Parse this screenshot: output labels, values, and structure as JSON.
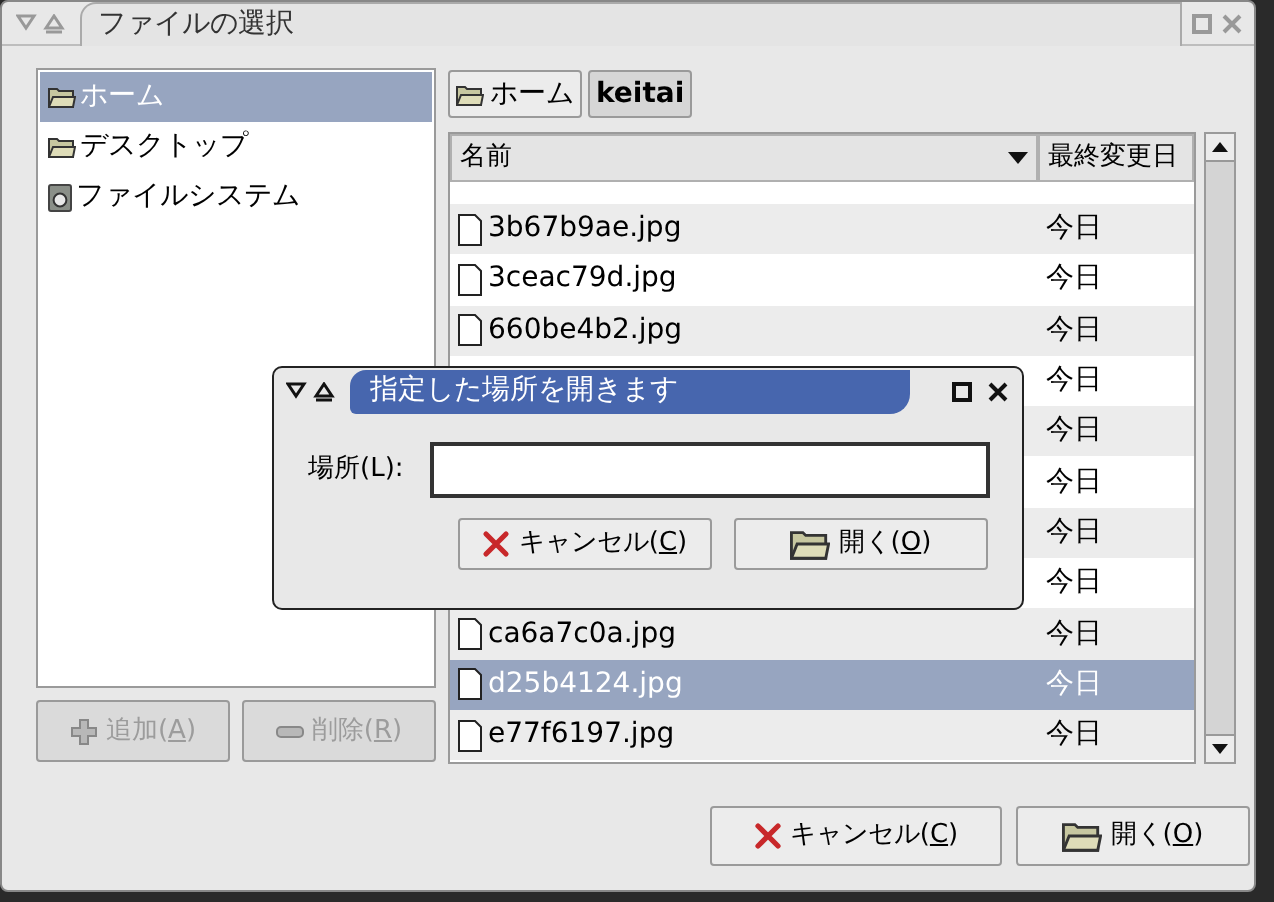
{
  "window": {
    "title": "ファイルの選択"
  },
  "places": [
    {
      "label": "ホーム",
      "kind": "folder",
      "selected": true
    },
    {
      "label": "デスクトップ",
      "kind": "folder",
      "selected": false
    },
    {
      "label": "ファイルシステム",
      "kind": "drive",
      "selected": false
    }
  ],
  "place_buttons": [
    {
      "label": "追加(A)",
      "kind": "add",
      "disabled": true
    },
    {
      "label": "削除(R)",
      "kind": "remove",
      "disabled": true
    }
  ],
  "path_buttons": [
    {
      "label": "ホーム",
      "kind": "folder",
      "selected": false
    },
    {
      "label": "keitai",
      "kind": "plain",
      "selected": true
    }
  ],
  "columns": [
    {
      "label": "名前",
      "sorted": true
    },
    {
      "label": "最終変更日",
      "sorted": false
    }
  ],
  "files": [
    {
      "name": "3b67b9ae.jpg",
      "modified": "今日",
      "selected": false
    },
    {
      "name": "3ceac79d.jpg",
      "modified": "今日",
      "selected": false
    },
    {
      "name": "660be4b2.jpg",
      "modified": "今日",
      "selected": false
    },
    {
      "modified": "今日",
      "selected": false
    },
    {
      "modified": "今日",
      "selected": false
    },
    {
      "modified": "今日",
      "selected": false
    },
    {
      "modified": "今日",
      "selected": false
    },
    {
      "modified": "今日",
      "selected": false
    },
    {
      "name": "ca6a7c0a.jpg",
      "modified": "今日",
      "selected": false
    },
    {
      "name": "d25b4124.jpg",
      "modified": "今日",
      "selected": true
    },
    {
      "name": "e77f6197.jpg",
      "modified": "今日",
      "selected": false
    }
  ],
  "buttons": [
    {
      "label": "キャンセル(C)",
      "kind": "cancel"
    },
    {
      "label": "開く(O)",
      "kind": "open"
    }
  ],
  "dialog": {
    "title": "指定した場所を開きます",
    "field_label": "場所(L):",
    "buttons": [
      {
        "label": "キャンセル(C)",
        "kind": "cancel"
      },
      {
        "label": "開く(O)",
        "kind": "open"
      }
    ]
  }
}
